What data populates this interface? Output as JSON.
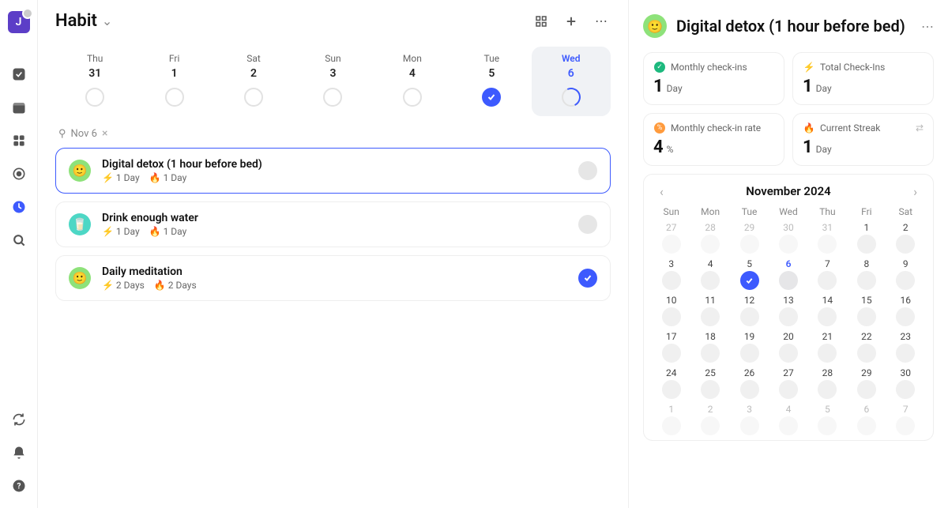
{
  "avatar_letter": "J",
  "page_title": "Habit",
  "week": [
    {
      "dow": "Thu",
      "num": "31",
      "state": "empty"
    },
    {
      "dow": "Fri",
      "num": "1",
      "state": "empty"
    },
    {
      "dow": "Sat",
      "num": "2",
      "state": "empty"
    },
    {
      "dow": "Sun",
      "num": "3",
      "state": "empty"
    },
    {
      "dow": "Mon",
      "num": "4",
      "state": "empty"
    },
    {
      "dow": "Tue",
      "num": "5",
      "state": "done"
    },
    {
      "dow": "Wed",
      "num": "6",
      "state": "partial",
      "current": true
    }
  ],
  "filter_label": "Nov 6",
  "habits": [
    {
      "emoji": "🙂",
      "emoji_bg": "green",
      "title": "Digital detox (1 hour before bed)",
      "bolt": "1 Day",
      "fire": "1 Day",
      "done": false,
      "selected": true
    },
    {
      "emoji": "🥛",
      "emoji_bg": "cyan",
      "title": "Drink enough water",
      "bolt": "1 Day",
      "fire": "1 Day",
      "done": false,
      "selected": false
    },
    {
      "emoji": "🙂",
      "emoji_bg": "green",
      "title": "Daily meditation",
      "bolt": "2 Days",
      "fire": "2 Days",
      "done": true,
      "selected": false
    }
  ],
  "panel": {
    "title": "Digital detox (1 hour before bed)",
    "stats": [
      {
        "icon": "check-green",
        "label": "Monthly check-ins",
        "value": "1",
        "unit": "Day"
      },
      {
        "icon": "bolt-blue",
        "label": "Total Check-Ins",
        "value": "1",
        "unit": "Day"
      },
      {
        "icon": "percent-orange",
        "label": "Monthly check-in rate",
        "value": "4",
        "unit": "%"
      },
      {
        "icon": "fire-red",
        "label": "Current Streak",
        "value": "1",
        "unit": "Day",
        "swap": true
      }
    ],
    "calendar": {
      "title": "November 2024",
      "dow": [
        "Sun",
        "Mon",
        "Tue",
        "Wed",
        "Thu",
        "Fri",
        "Sat"
      ],
      "cells": [
        {
          "n": "27",
          "dim": true
        },
        {
          "n": "28",
          "dim": true
        },
        {
          "n": "29",
          "dim": true
        },
        {
          "n": "30",
          "dim": true
        },
        {
          "n": "31",
          "dim": true
        },
        {
          "n": "1"
        },
        {
          "n": "2"
        },
        {
          "n": "3"
        },
        {
          "n": "4"
        },
        {
          "n": "5",
          "done": true
        },
        {
          "n": "6",
          "today": true,
          "shadow": true
        },
        {
          "n": "7"
        },
        {
          "n": "8"
        },
        {
          "n": "9"
        },
        {
          "n": "10"
        },
        {
          "n": "11"
        },
        {
          "n": "12"
        },
        {
          "n": "13"
        },
        {
          "n": "14"
        },
        {
          "n": "15"
        },
        {
          "n": "16"
        },
        {
          "n": "17"
        },
        {
          "n": "18"
        },
        {
          "n": "19"
        },
        {
          "n": "20"
        },
        {
          "n": "21"
        },
        {
          "n": "22"
        },
        {
          "n": "23"
        },
        {
          "n": "24"
        },
        {
          "n": "25"
        },
        {
          "n": "26"
        },
        {
          "n": "27"
        },
        {
          "n": "28"
        },
        {
          "n": "29"
        },
        {
          "n": "30"
        },
        {
          "n": "1",
          "dim": true
        },
        {
          "n": "2",
          "dim": true
        },
        {
          "n": "3",
          "dim": true
        },
        {
          "n": "4",
          "dim": true
        },
        {
          "n": "5",
          "dim": true
        },
        {
          "n": "6",
          "dim": true
        },
        {
          "n": "7",
          "dim": true
        }
      ]
    }
  }
}
